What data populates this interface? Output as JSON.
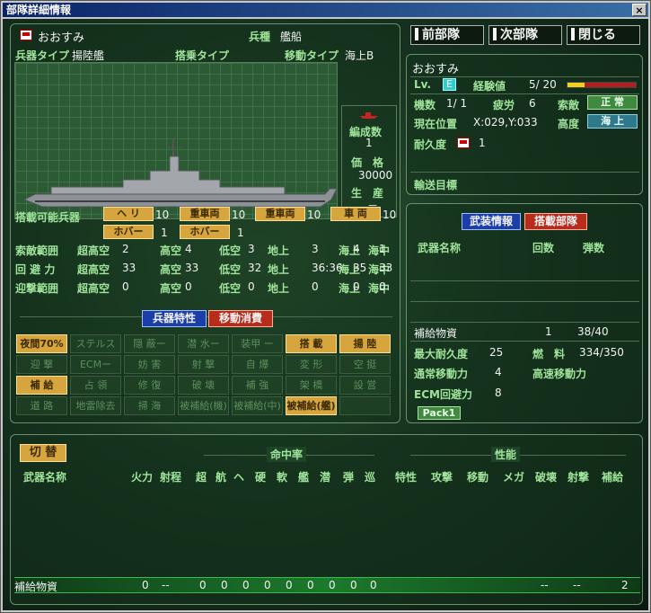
{
  "window": {
    "title": "部隊詳細情報",
    "close": "×"
  },
  "top_buttons": {
    "prev": "前部隊",
    "next": "次部隊",
    "close": "閉じる"
  },
  "unit": {
    "name": "おおすみ",
    "type_label": "兵種",
    "type_value": "艦船",
    "weapon_type_label": "兵器タイプ",
    "weapon_type_value": "揚陸艦",
    "boarding_type_label": "搭乗タイプ",
    "move_type_label": "移動タイプ",
    "move_type_value": "海上B",
    "formation_label": "編成数",
    "formation_value": "1",
    "price_label": "価　格",
    "price_value": "30000",
    "production_label": "生　産",
    "production_value": "－"
  },
  "carry": {
    "label": "搭載可能兵器",
    "items": [
      {
        "tag": "ヘ リ",
        "value": "10"
      },
      {
        "tag": "重車両",
        "value": "10"
      },
      {
        "tag": "重車両",
        "value": "10"
      },
      {
        "tag": "車 両",
        "value": "10"
      },
      {
        "tag": "ホバー",
        "value": "1"
      },
      {
        "tag": "ホバー",
        "value": "1"
      }
    ]
  },
  "ranges": [
    {
      "label": "索敵範囲",
      "cols": [
        "超高空",
        "2",
        "高空",
        "4",
        "低空",
        "3",
        "地上",
        "3",
        "海上",
        "4",
        "海中",
        "1"
      ]
    },
    {
      "label": "回 避 力",
      "cols": [
        "超高空",
        "33",
        "高空",
        "33",
        "低空",
        "32",
        "地上",
        "36:36",
        "海上",
        "35",
        "海中",
        "33"
      ]
    },
    {
      "label": "迎撃範囲",
      "cols": [
        "超高空",
        "0",
        "高空",
        "0",
        "低空",
        "0",
        "地上",
        "0",
        "海上",
        "0",
        "海中",
        "0"
      ]
    }
  ],
  "tabs_left": {
    "traits": "兵器特性",
    "move_cost": "移動消費"
  },
  "traits_grid": [
    [
      {
        "t": "夜間70%",
        "on": true
      },
      {
        "t": "ステルス",
        "on": false
      },
      {
        "t": "隠 蔽ー",
        "on": false
      },
      {
        "t": "潜 水ー",
        "on": false
      },
      {
        "t": "装甲 ー",
        "on": false
      },
      {
        "t": "搭 載",
        "on": true
      },
      {
        "t": "揚 陸",
        "on": true
      }
    ],
    [
      {
        "t": "迎 撃",
        "on": false
      },
      {
        "t": "ECMー",
        "on": false
      },
      {
        "t": "妨 害",
        "on": false
      },
      {
        "t": "射 撃",
        "on": false
      },
      {
        "t": "自 爆",
        "on": false
      },
      {
        "t": "変 形",
        "on": false
      },
      {
        "t": "空 挺",
        "on": false
      }
    ],
    [
      {
        "t": "補 給",
        "on": true
      },
      {
        "t": "占 領",
        "on": false
      },
      {
        "t": "修 復",
        "on": false
      },
      {
        "t": "破 壊",
        "on": false
      },
      {
        "t": "補 強",
        "on": false
      },
      {
        "t": "架 橋",
        "on": false
      },
      {
        "t": "設 営",
        "on": false
      }
    ],
    [
      {
        "t": "道 路",
        "on": false
      },
      {
        "t": "地雷除去",
        "on": false
      },
      {
        "t": "掃 海",
        "on": false
      },
      {
        "t": "被補給(機)",
        "on": false
      },
      {
        "t": "被補給(中)",
        "on": false
      },
      {
        "t": "被補給(艦)",
        "on": true
      },
      {
        "t": "",
        "on": false
      }
    ]
  ],
  "status": {
    "name": "おおすみ",
    "lv_label": "Lv.",
    "lv_value": "E",
    "exp_label": "経験値",
    "exp_value": "5/ 20",
    "exp_fraction": 0.25,
    "units_label": "機数",
    "units_value": "1/ 1",
    "fatigue_label": "疲労",
    "fatigue_value": "6",
    "enemy_label": "索敵",
    "enemy_value": "正 常",
    "pos_label": "現在位置",
    "pos_value": "X:029,Y:033",
    "alt_label": "高度",
    "alt_value": "海 上",
    "dur_label": "耐久度",
    "dur_value": "1",
    "transport_label": "輸送目標"
  },
  "weapon_tabs": {
    "arms": "武装情報",
    "cargo": "搭載部隊"
  },
  "weapon_header": {
    "name": "武器名称",
    "count": "回数",
    "ammo": "弾数"
  },
  "supply": {
    "name": "補給物資",
    "count": "1",
    "ammo": "38/40"
  },
  "endurance": {
    "max_label": "最大耐久度",
    "max_value": "25",
    "fuel_label": "燃　料",
    "fuel_value": "334/350",
    "normal_label": "通常移動力",
    "normal_value": "4",
    "fast_label": "高速移動力",
    "ecm_label": "ECM回避力",
    "ecm_value": "8",
    "pack": "Pack1"
  },
  "bottom": {
    "switch": "切 替",
    "hit_group": "命中率",
    "perf_group": "性能",
    "columns": [
      "武器名称",
      "火力",
      "射程",
      "超",
      "航",
      "ヘ",
      "硬",
      "軟",
      "艦",
      "潜",
      "弾",
      "巡",
      "特性",
      "攻撃",
      "移動",
      "メガ",
      "破壊",
      "射撃",
      "補給"
    ],
    "row": [
      "補給物資",
      "0",
      "--",
      "0",
      "0",
      "0",
      "0",
      "0",
      "0",
      "0",
      "0",
      "0",
      "",
      "",
      "",
      "--",
      "--",
      "",
      "2"
    ]
  }
}
